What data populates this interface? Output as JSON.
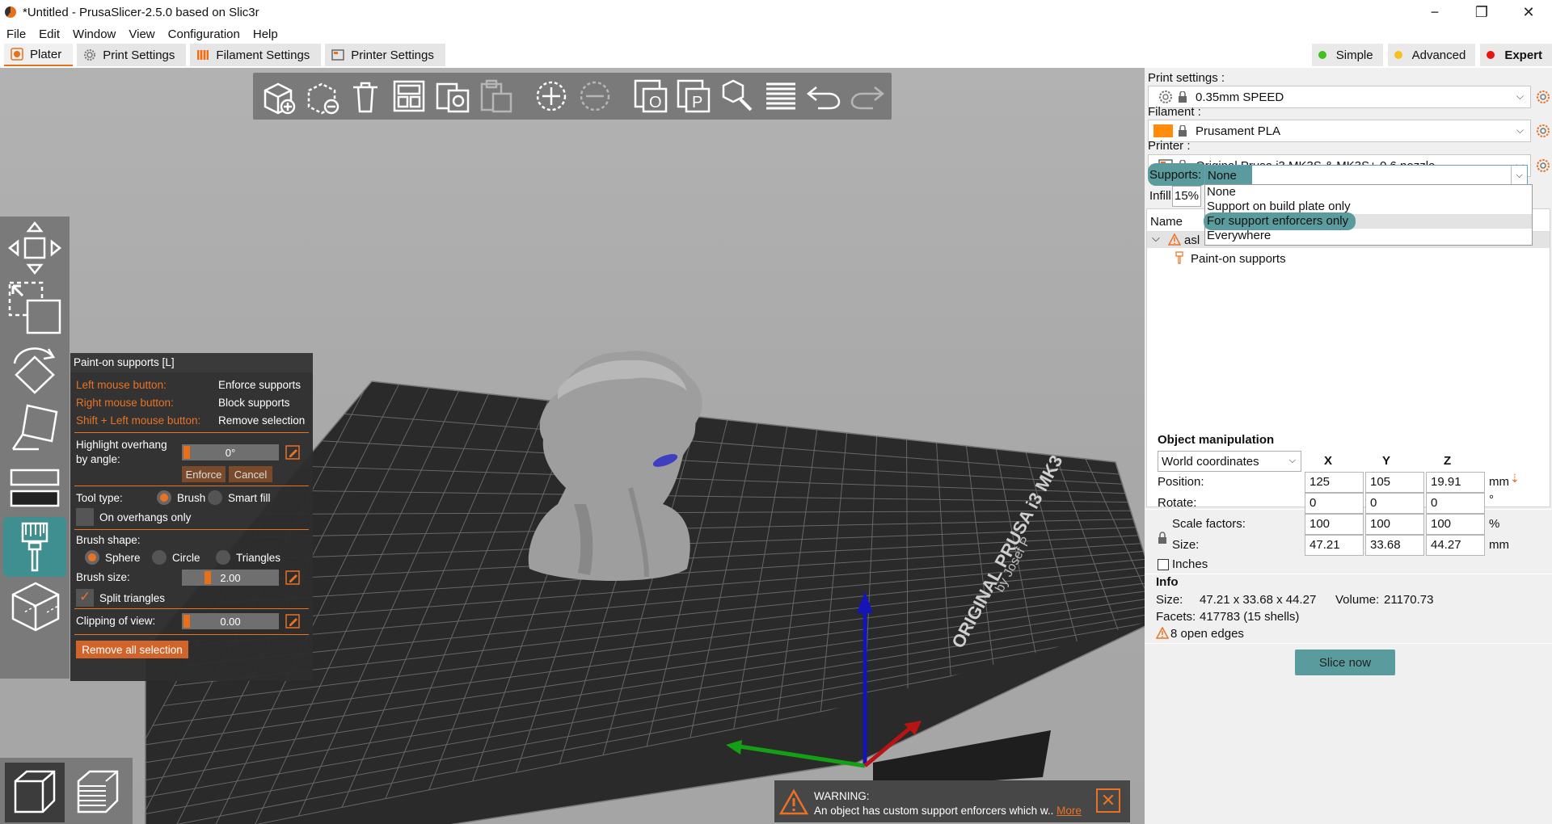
{
  "window": {
    "title": "*Untitled - PrusaSlicer-2.5.0 based on Slic3r",
    "minimize": "−",
    "maximize": "❐",
    "close": "✕"
  },
  "menu": [
    "File",
    "Edit",
    "Window",
    "View",
    "Configuration",
    "Help"
  ],
  "tabs": [
    {
      "label": "Plater",
      "active": true
    },
    {
      "label": "Print Settings",
      "active": false
    },
    {
      "label": "Filament Settings",
      "active": false
    },
    {
      "label": "Printer Settings",
      "active": false
    }
  ],
  "modes": [
    {
      "label": "Simple",
      "color": "#44c11f",
      "selected": false
    },
    {
      "label": "Advanced",
      "color": "#f5c11b",
      "selected": false
    },
    {
      "label": "Expert",
      "color": "#e8160f",
      "selected": true
    }
  ],
  "top_toolbar_icons": [
    "add-icon",
    "delete-icon",
    "delete-all-icon",
    "arrange-icon",
    "copy-icon",
    "paste-icon",
    "add-instance-icon",
    "remove-instance-icon",
    "split-objects-icon",
    "split-parts-icon",
    "search-icon",
    "layers-editing-icon",
    "undo-icon",
    "redo-icon"
  ],
  "left_toolbar_icons": [
    "move-icon",
    "scale-icon",
    "rotate-icon",
    "place-on-face-icon",
    "cut-icon",
    "paint-supports-icon",
    "simplify-icon"
  ],
  "paint_panel": {
    "title": "Paint-on supports [L]",
    "left_mouse": "Left mouse button:",
    "left_action": "Enforce supports",
    "right_mouse": "Right mouse button:",
    "right_action": "Block supports",
    "shift_left": "Shift + Left mouse button:",
    "shift_action": "Remove selection",
    "highlight_label_1": "Highlight overhang",
    "highlight_label_2": "by angle:",
    "angle_value": "0°",
    "enforce_btn": "Enforce",
    "cancel_btn": "Cancel",
    "tool_type_label": "Tool type:",
    "tool_brush": "Brush",
    "tool_smart_fill": "Smart fill",
    "on_overhangs_only": "On overhangs only",
    "brush_shape_label": "Brush shape:",
    "shape_sphere": "Sphere",
    "shape_circle": "Circle",
    "shape_triangles": "Triangles",
    "brush_size_label": "Brush size:",
    "brush_size_value": "2.00",
    "split_triangles": "Split triangles",
    "clipping_label": "Clipping of view:",
    "clipping_value": "0.00",
    "remove_all": "Remove all selection"
  },
  "bed": {
    "label": "ORIGINAL PRUSA i3  MK3",
    "sublabel": "by Josef P"
  },
  "warning": {
    "title": "WARNING:",
    "text": "An object has custom support enforcers which w..",
    "more": "More"
  },
  "sidebar": {
    "print_settings_label": "Print settings :",
    "print_settings_value": "0.35mm SPEED",
    "filament_label": "Filament :",
    "filament_value": "Prusament PLA",
    "filament_color": "#ff8c0a",
    "printer_label": "Printer :",
    "printer_value": "Original Prusa i3 MK3S & MK3S+ 0.6 nozzle",
    "supports_label": "Supports:",
    "supports_value": "None",
    "infill_label": "Infill:",
    "infill_value": "15%",
    "supports_options": [
      "None",
      "Support on build plate only",
      "For support enforcers only",
      "Everywhere"
    ],
    "tree_header_name": "Name",
    "object_name": "asl",
    "paint_on_supports": "Paint-on supports"
  },
  "object_manipulation": {
    "title": "Object manipulation",
    "coordinates": "World coordinates",
    "axes": [
      "X",
      "Y",
      "Z"
    ],
    "position_label": "Position:",
    "position": [
      "125",
      "105",
      "19.91"
    ],
    "position_unit": "mm",
    "rotate_label": "Rotate:",
    "rotate": [
      "0",
      "0",
      "0"
    ],
    "rotate_unit": "°",
    "scale_label": "Scale factors:",
    "scale": [
      "100",
      "100",
      "100"
    ],
    "scale_unit": "%",
    "size_label": "Size:",
    "size": [
      "47.21",
      "33.68",
      "44.27"
    ],
    "size_unit": "mm",
    "inches_label": "Inches"
  },
  "info": {
    "title": "Info",
    "size_label": "Size:",
    "size_value": "47.21 x 33.68 x 44.27",
    "volume_label": "Volume:",
    "volume_value": "21170.73",
    "facets_label": "Facets:",
    "facets_value": "417783 (15 shells)",
    "open_edges": "8 open edges"
  },
  "slice_button": "Slice now"
}
